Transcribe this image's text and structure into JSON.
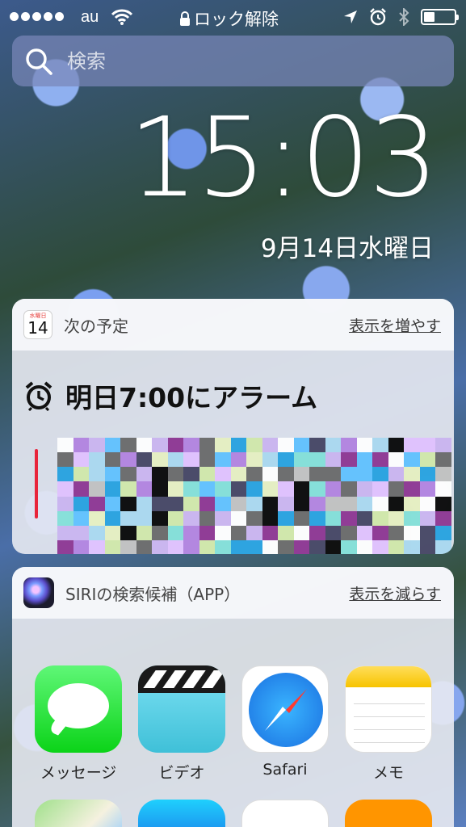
{
  "status_bar": {
    "carrier": "au",
    "center_text": "ロック解除",
    "battery_level": 0.35
  },
  "search": {
    "placeholder": "検索"
  },
  "lockscreen": {
    "time": "15:03",
    "date": "9月14日水曜日"
  },
  "calendar_widget": {
    "title": "次の予定",
    "action": "表示を増やす",
    "icon_weekday": "水曜日",
    "icon_day": "14",
    "alarm_text": "明日7:00にアラーム",
    "accent_color": "#e8243b"
  },
  "siri_widget": {
    "title": "SIRIの検索候補（APP）",
    "action": "表示を減らす",
    "apps": [
      {
        "label": "メッセージ",
        "icon": "messages-icon"
      },
      {
        "label": "ビデオ",
        "icon": "videos-icon"
      },
      {
        "label": "Safari",
        "icon": "safari-icon"
      },
      {
        "label": "メモ",
        "icon": "notes-icon"
      }
    ],
    "partial_apps": [
      {
        "icon": "maps-icon"
      },
      {
        "icon": "app-store-icon"
      },
      {
        "icon": "photos-icon"
      },
      {
        "icon": "calculator-icon"
      }
    ]
  }
}
